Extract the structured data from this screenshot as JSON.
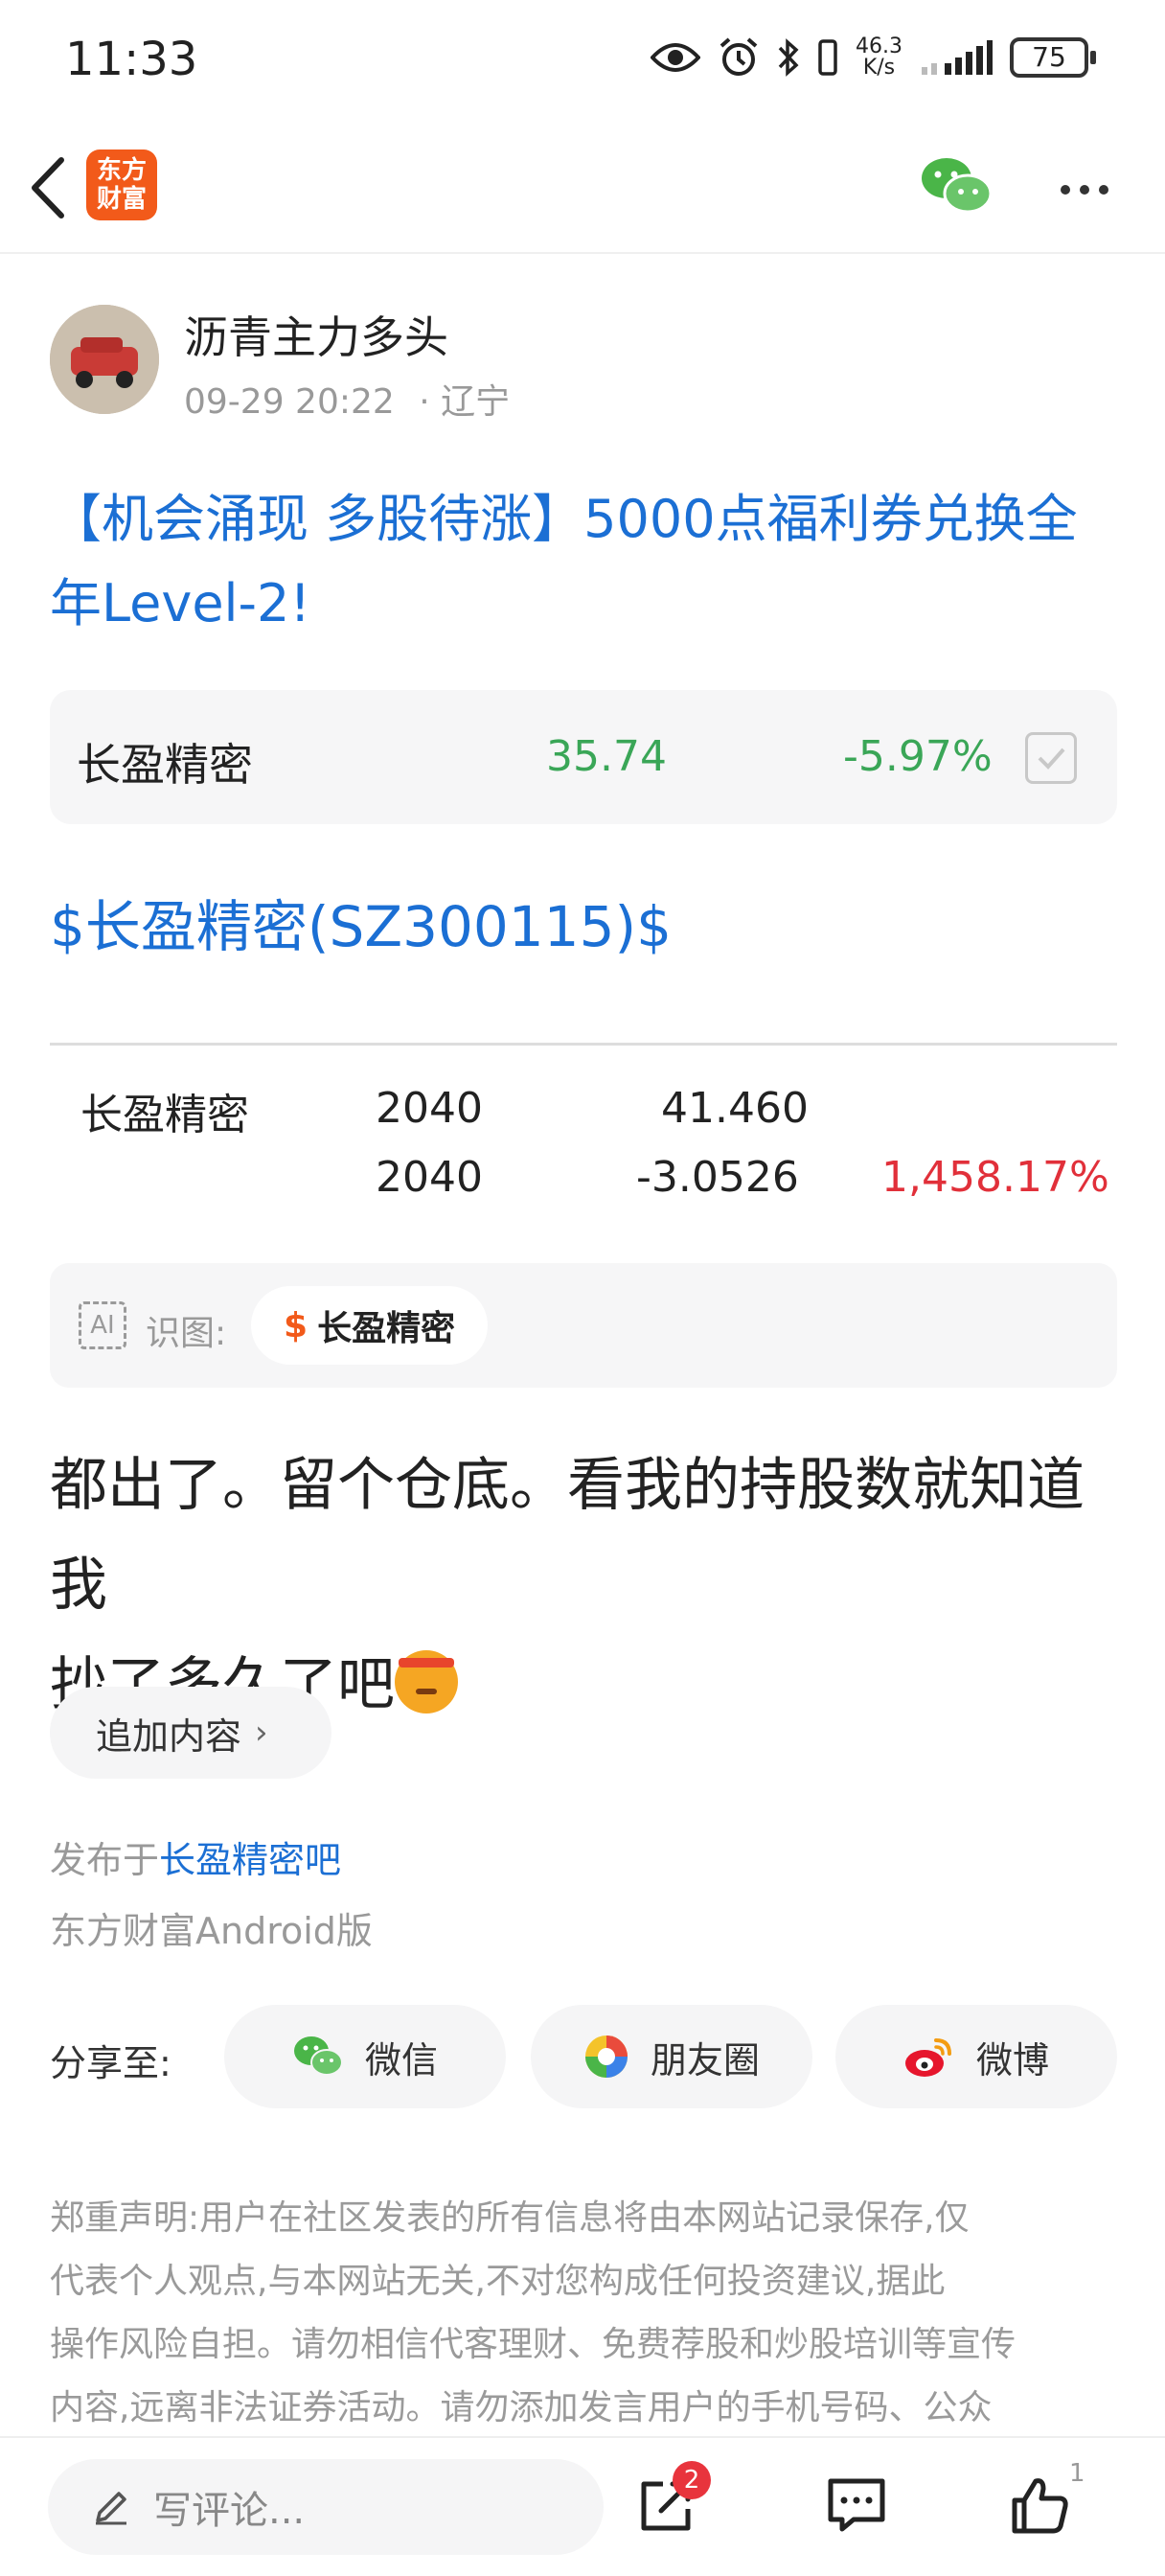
{
  "status_bar": {
    "time": "11:33",
    "net_speed_value": "46.3",
    "net_speed_unit": "K/s",
    "battery": "75",
    "icons": [
      "eye-icon",
      "alarm-icon",
      "bluetooth-icon",
      "vibrate-icon",
      "signal-icon",
      "battery-icon"
    ]
  },
  "header": {
    "app_logo_line1": "东方",
    "app_logo_line2": "财富",
    "brand_color": "#f25a1a",
    "icons": [
      "back-arrow-icon",
      "wechat-icon",
      "more-icon"
    ]
  },
  "post": {
    "author": "沥青主力多头",
    "datetime": "09-29 20:22",
    "location": "· 辽宁",
    "title": "【机会涌现 多股待涨】5000点福利券兑换全年Level-2!",
    "link_color": "#1b6fd4",
    "stock_card": {
      "name": "长盈精密",
      "price": "35.74",
      "change": "-5.97%",
      "color": "#3aa657"
    },
    "stock_tag": "$长盈精密(SZ300115)$",
    "holdings": {
      "name": "长盈精密",
      "row1": {
        "qty": "2040",
        "value": "41.460",
        "pct": ""
      },
      "row2": {
        "qty": "2040",
        "value": "-3.0526",
        "pct": "1,458.17%"
      },
      "pct_color": "#e1303a"
    },
    "ai_recognition": {
      "icon_text": "AI",
      "label": "识图:",
      "chip_symbol": "$",
      "chip_label": "长盈精密"
    },
    "body_line1": "都出了。留个仓底。看我的持股数就知道我",
    "body_line2": "抄了多久了吧",
    "body_emoji": "angry-face-with-headband-emoji",
    "append_button": "追加内容",
    "published_prefix": "发布于",
    "published_forum": "长盈精密吧",
    "platform": "东方财富Android版"
  },
  "share": {
    "label": "分享至:",
    "buttons": [
      {
        "label": "微信",
        "icon": "wechat-icon"
      },
      {
        "label": "朋友圈",
        "icon": "moments-icon"
      },
      {
        "label": "微博",
        "icon": "weibo-icon"
      }
    ]
  },
  "disclaimer": {
    "line1": "郑重声明:用户在社区发表的所有信息将由本网站记录保存,仅",
    "line2": "代表个人观点,与本网站无关,不对您构成任何投资建议,据此",
    "line3": "操作风险自担。请勿相信代客理财、免费荐股和炒股培训等宣传",
    "line4": "内容,远离非法证券活动。请勿添加发言用户的手机号码、公众"
  },
  "bottom_bar": {
    "comment_placeholder": "写评论...",
    "share_badge": "2",
    "like_count": "1",
    "icons": [
      "pencil-icon",
      "share-icon",
      "comment-icon",
      "thumbs-up-icon"
    ]
  }
}
